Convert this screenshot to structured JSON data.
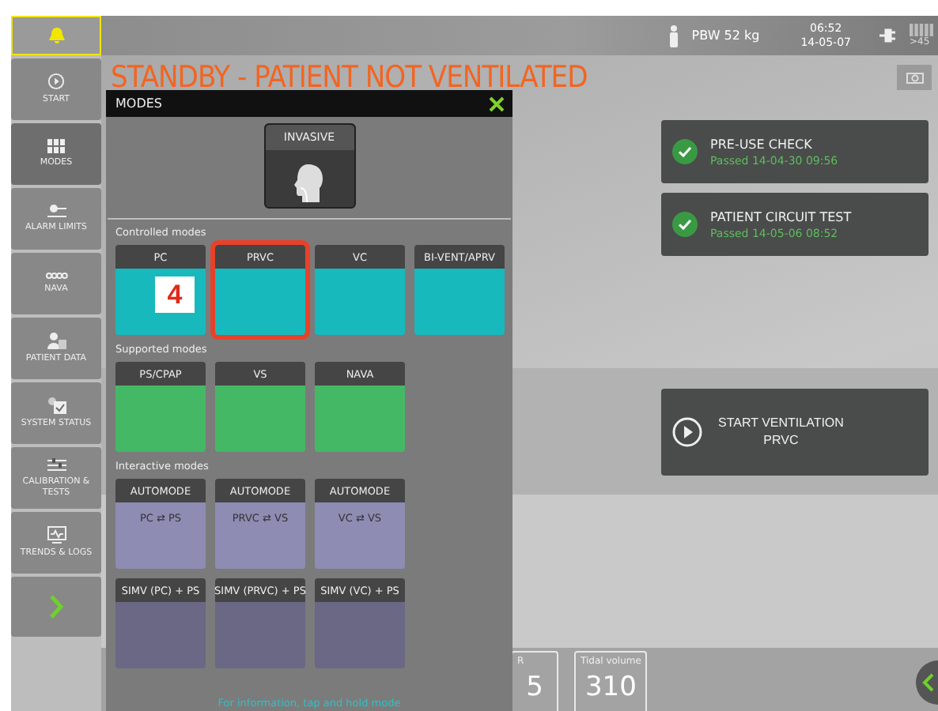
{
  "top_bar": {
    "alarm_button": {
      "active": true
    },
    "patient_weight": "PBW 52 kg",
    "time": "06:52",
    "date": "14-05-07",
    "battery_text": ">45"
  },
  "sidebar": {
    "items": [
      {
        "label": "START",
        "selected": false
      },
      {
        "label": "MODES",
        "selected": true
      },
      {
        "label": "ALARM LIMITS",
        "selected": false
      },
      {
        "label": "NAVA",
        "selected": false
      },
      {
        "label": "PATIENT DATA",
        "selected": false
      },
      {
        "label": "SYSTEM STATUS",
        "selected": false
      },
      {
        "label": "CALIBRATION & TESTS",
        "selected": false
      },
      {
        "label": "TRENDS & LOGS",
        "selected": false
      }
    ]
  },
  "status_title": "STANDBY  -  PATIENT NOT VENTILATED",
  "checks": [
    {
      "title": "PRE-USE CHECK",
      "result": "Passed  14-04-30  09:56"
    },
    {
      "title": "PATIENT CIRCUIT TEST",
      "result": "Passed  14-05-06  08:52"
    }
  ],
  "start_ventilation": {
    "title": "START VENTILATION",
    "mode": "PRVC"
  },
  "parameters": [
    {
      "label": "R",
      "value": "5"
    },
    {
      "label": "Tidal volume",
      "value": "310"
    }
  ],
  "modes_dialog": {
    "title": "MODES",
    "patient_type": "INVASIVE",
    "groups": [
      {
        "label": "Controlled modes",
        "modes": [
          {
            "title": "PC",
            "color": "#17b9bd",
            "marker": "4",
            "selected": false
          },
          {
            "title": "PRVC",
            "color": "#17b9bd",
            "selected": true
          },
          {
            "title": "VC",
            "color": "#17b9bd",
            "selected": false
          },
          {
            "title": "BI-VENT/APRV",
            "color": "#17b9bd",
            "selected": false
          }
        ]
      },
      {
        "label": "Supported modes",
        "modes": [
          {
            "title": "PS/CPAP",
            "color": "#45b865",
            "selected": false
          },
          {
            "title": "VS",
            "color": "#45b865",
            "selected": false
          },
          {
            "title": "NAVA",
            "color": "#45b865",
            "selected": false
          }
        ]
      },
      {
        "label": "Interactive modes",
        "modes": [
          {
            "title": "AUTOMODE",
            "body": "PC ⇄ PS",
            "color": "#8e8cb3",
            "selected": false
          },
          {
            "title": "AUTOMODE",
            "body": "PRVC ⇄ VS",
            "color": "#8e8cb3",
            "selected": false
          },
          {
            "title": "AUTOMODE",
            "body": "VC ⇄ VS",
            "color": "#8e8cb3",
            "selected": false
          },
          {
            "title": "SIMV (PC) + PS",
            "color": "#6a6885",
            "selected": false
          },
          {
            "title": "SIMV (PRVC) + PS",
            "color": "#6a6885",
            "selected": false
          },
          {
            "title": "SIMV (VC) + PS",
            "color": "#6a6885",
            "selected": false
          }
        ]
      }
    ],
    "hint": "For information, tap and hold mode"
  }
}
